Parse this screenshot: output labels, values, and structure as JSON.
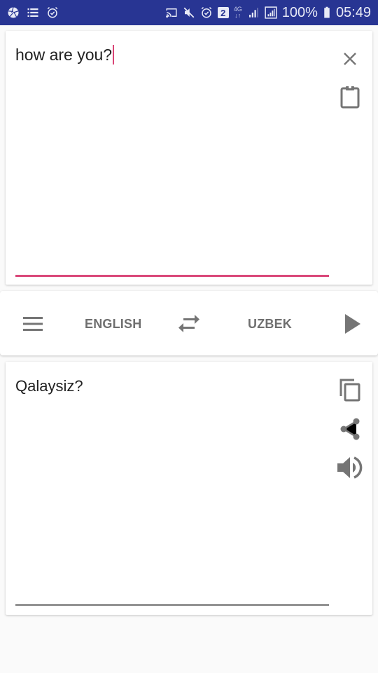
{
  "status_bar": {
    "left_icons": [
      "aperture-icon",
      "list-icon",
      "alarm-check-icon"
    ],
    "right_icons": [
      "cast-icon",
      "mute-icon",
      "alarm-icon",
      "sim2-badge",
      "4g-icon",
      "signal-icon",
      "signal-boxed-icon",
      "battery-icon"
    ],
    "sim_badge": "2",
    "network_type": "4G",
    "network_sub": "↓↑",
    "battery": "100%",
    "time": "05:49"
  },
  "input_card": {
    "text": "how are you?",
    "clear_icon": "close-icon",
    "paste_icon": "clipboard-icon",
    "accent_color": "#d9487a"
  },
  "language_bar": {
    "menu_icon": "menu-icon",
    "source_language": "ENGLISH",
    "swap_icon": "swap-icon",
    "target_language": "UZBEK",
    "translate_icon": "play-icon"
  },
  "output_card": {
    "text": "Qalaysiz?",
    "copy_icon": "copy-icon",
    "share_icon": "share-icon",
    "speak_icon": "volume-icon"
  },
  "colors": {
    "status_bar": "#283593",
    "icon_grey": "#757575",
    "label_grey": "#6f6f6f",
    "background": "#fafafa"
  }
}
